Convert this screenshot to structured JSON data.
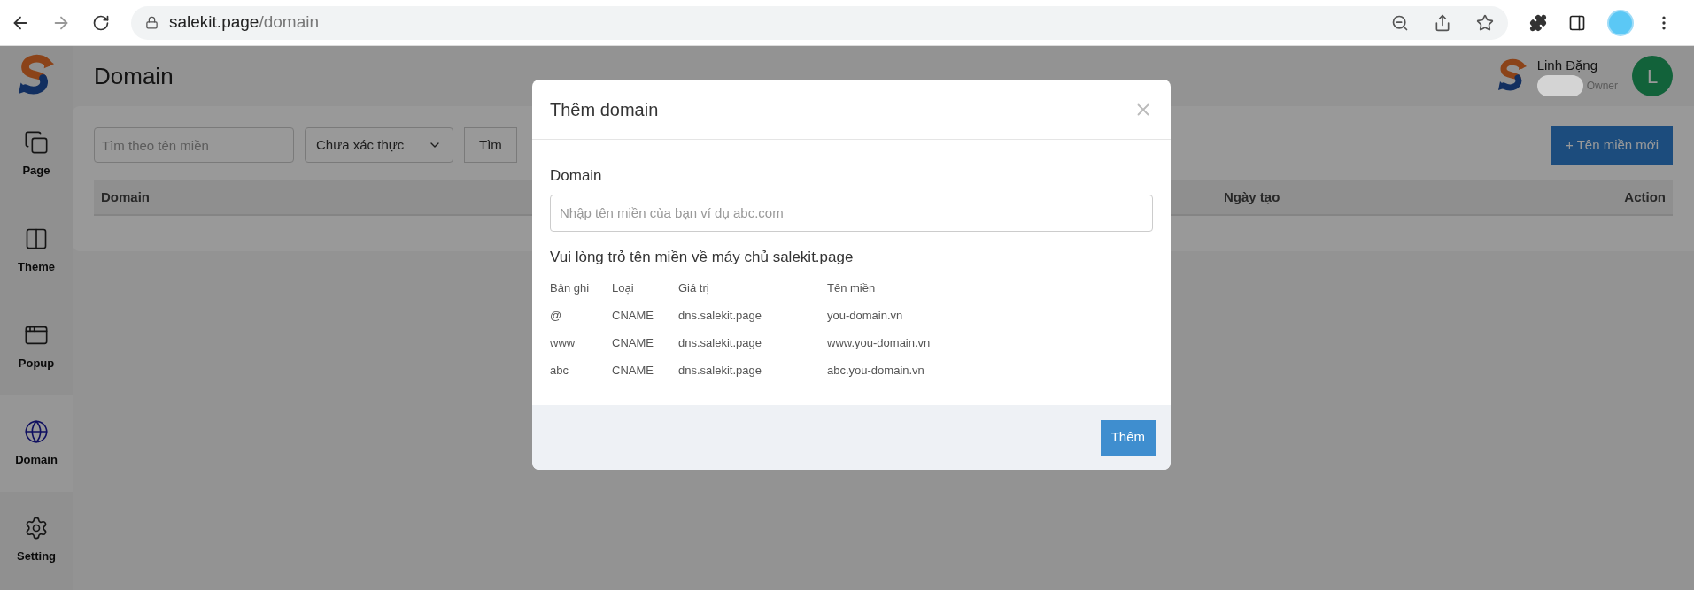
{
  "browser": {
    "host": "salekit.page",
    "path": "/domain"
  },
  "sidebar": {
    "items": [
      {
        "label": "Page",
        "kind": "page",
        "selected": false
      },
      {
        "label": "Theme",
        "kind": "theme",
        "selected": false
      },
      {
        "label": "Popup",
        "kind": "popup",
        "selected": false
      },
      {
        "label": "Domain",
        "kind": "domain",
        "selected": true
      },
      {
        "label": "Setting",
        "kind": "setting",
        "selected": false
      }
    ]
  },
  "header": {
    "title": "Domain",
    "user": {
      "name": "Linh Đặng",
      "role": "Owner",
      "avatar_letter": "L"
    }
  },
  "toolbar": {
    "search": {
      "placeholder": "Tìm theo tên miền"
    },
    "filter": {
      "value": "Chưa xác thực"
    },
    "search_button": "Tìm",
    "new_button": "+ Tên miền mới"
  },
  "table": {
    "columns": [
      "Domain",
      "Ngày tạo",
      "Action"
    ]
  },
  "modal": {
    "title": "Thêm domain",
    "field_label": "Domain",
    "field": {
      "placeholder": "Nhập tên miền của bạn ví dụ abc.com"
    },
    "note": "Vui lòng trỏ tên miền về máy chủ salekit.page",
    "records": {
      "columns": [
        "Bản ghi",
        "Loại",
        "Giá trị",
        "Tên miền"
      ],
      "rows": [
        [
          "@",
          "CNAME",
          "dns.salekit.page",
          "you-domain.vn"
        ],
        [
          "www",
          "CNAME",
          "dns.salekit.page",
          "www.you-domain.vn"
        ],
        [
          "abc",
          "CNAME",
          "dns.salekit.page",
          "abc.you-domain.vn"
        ]
      ]
    },
    "submit": "Thêm"
  }
}
